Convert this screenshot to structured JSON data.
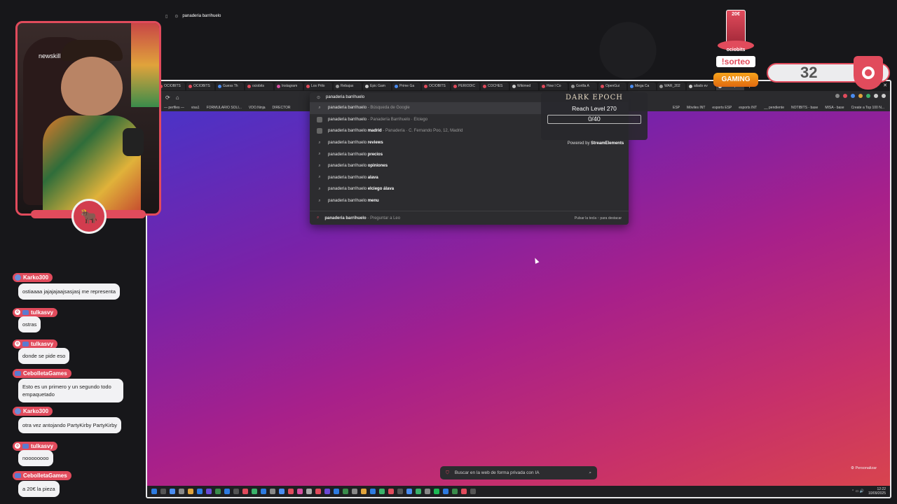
{
  "browser": {
    "tabs": [
      {
        "label": "OCIOBITS",
        "color": "#e14b5c"
      },
      {
        "label": "OCIOBITS",
        "color": "#e14b5c"
      },
      {
        "label": "Guess Th",
        "color": "#4a8cf0"
      },
      {
        "label": "ociobits",
        "color": "#e14b5c"
      },
      {
        "label": "Instagram",
        "color": "#d64fa0"
      },
      {
        "label": "Los Prilo",
        "color": "#e14b5c"
      },
      {
        "label": "Rebajas",
        "color": "#999999"
      },
      {
        "label": "Epic Gam",
        "color": "#cccccc"
      },
      {
        "label": "Prime Ga",
        "color": "#4a8cf0"
      },
      {
        "label": "OCIOBITS",
        "color": "#e14b5c"
      },
      {
        "label": "PERIODIC",
        "color": "#e14b5c"
      },
      {
        "label": "COCHES",
        "color": "#e14b5c"
      },
      {
        "label": "Wikimed",
        "color": "#cccccc"
      },
      {
        "label": "How I Co",
        "color": "#e14b5c"
      },
      {
        "label": "Gorilla A",
        "color": "#999999"
      },
      {
        "label": "OpenGui",
        "color": "#e14b5c"
      },
      {
        "label": "Mega Ca",
        "color": "#4a8cf0"
      },
      {
        "label": "WAR_202",
        "color": "#999999"
      },
      {
        "label": "ailads ev",
        "color": "#cccccc"
      },
      {
        "label": "Nueva pe",
        "color": "#cccccc",
        "active": true
      }
    ],
    "omnibox_value": "panaderia barrihuelo",
    "bookmarks_left": [
      "— perfiles —",
      "visa1",
      "FORMULARIO SOLI...",
      "VDO.Ninja",
      "DIRECTOR"
    ],
    "bookmarks_right": [
      "ESP",
      "Móviles INT",
      "esports ESP",
      "esports INT",
      "__ pendiente",
      "NOTIBITS - base",
      "MISA - base",
      "Create a Top 100 N..."
    ],
    "suggestions": [
      {
        "bold": "",
        "text": "panaderia barrihuelo",
        "sub": " - Búsqueda de Google",
        "icon": "search-icon",
        "selected": true
      },
      {
        "bold": "",
        "text": "panaderia barrihuelo",
        "sub": " - Panadería Barrihuelo · Elciego",
        "icon": "place-image-icon"
      },
      {
        "bold": " madrid",
        "text": "panaderia barrihuelo",
        "sub": " - Panadería · C. Fernando Poo, 12, Madrid",
        "icon": "place-image-icon"
      },
      {
        "bold": " reviews",
        "text": "panaderia barrihuelo",
        "sub": "",
        "icon": "search-icon"
      },
      {
        "bold": " precios",
        "text": "panaderia barrihuelo",
        "sub": "",
        "icon": "search-icon"
      },
      {
        "bold": " opiniones",
        "text": "panaderia barrihuelo",
        "sub": "",
        "icon": "search-icon"
      },
      {
        "bold": " alava",
        "text": "panaderia barrihuelo",
        "sub": "",
        "icon": "search-icon"
      },
      {
        "bold": " elciego álava",
        "text": "panaderia barrihuelo",
        "sub": "",
        "icon": "search-icon"
      },
      {
        "bold": " menu",
        "text": "panaderia barrihuelo",
        "sub": "",
        "icon": "search-icon"
      }
    ],
    "leo": {
      "query": "panaderia barrihuelo",
      "sub": " - Preguntar a Leo",
      "hint": "Pulsar la tecla ↑ para destacar"
    },
    "private_search_placeholder": "Buscar en la web de forma privada con IA",
    "personalize_label": "Personalizar",
    "clock": {
      "time": "12:22",
      "date": "10/09/2025"
    }
  },
  "widget": {
    "logo": "DARK EPOCH",
    "goal": "Reach Level 270",
    "progress": "0/40",
    "powered_prefix": "Powered by ",
    "powered_brand": "StreamElements"
  },
  "overlay": {
    "prize": "20€",
    "brand": "ociobits",
    "sorteo": "!sorteo",
    "gaming": "GAMING",
    "counter": "32",
    "cam_brand": "newskill"
  },
  "chat": [
    {
      "user": "Karko300",
      "badge": "avatar",
      "text": "ostiaaaa jajajajaajsasjasj me representa"
    },
    {
      "user": "tulkasvy",
      "badge": "prime",
      "text": "ostras"
    },
    {
      "user": "tulkasvy",
      "badge": "prime",
      "text": "donde se pide eso"
    },
    {
      "user": "CebolletaGames",
      "badge": "prime-only",
      "text": "Esto es un primero y un segundo todo empaquetado"
    },
    {
      "user": "Karko300",
      "badge": "avatar",
      "text": "otra vez antojando PartyKirby PartyKirby"
    },
    {
      "user": "tulkasvy",
      "badge": "prime",
      "text": "noooooooo"
    },
    {
      "user": "CebolletaGames",
      "badge": "prime-only",
      "text": "a 20€ la pieza"
    }
  ],
  "colors": {
    "accent": "#e14b5c",
    "bubble": "#f2f2f4"
  }
}
